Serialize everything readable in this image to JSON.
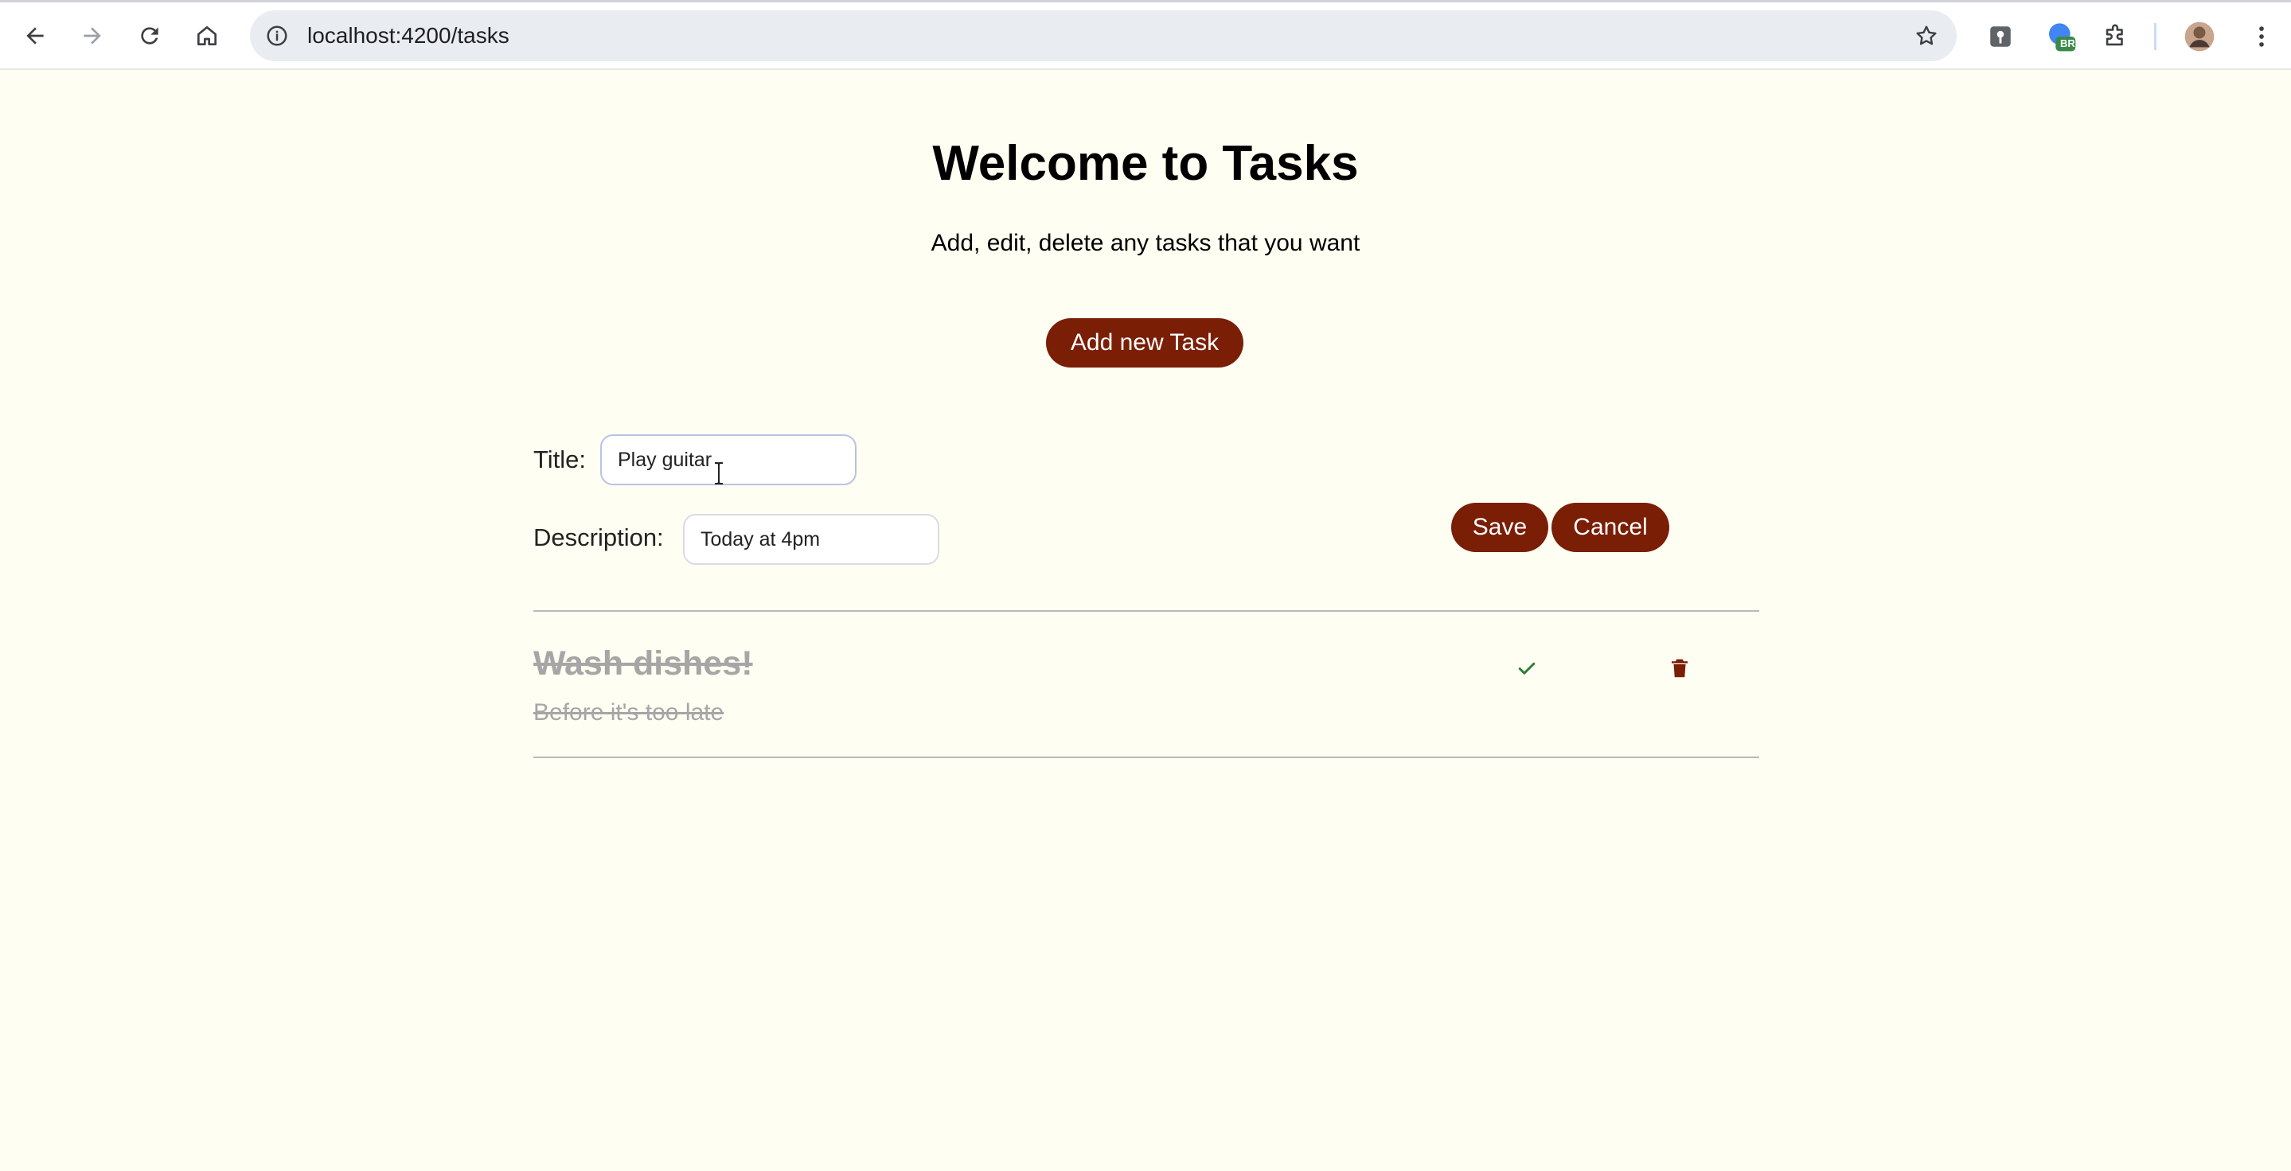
{
  "browser": {
    "url": "localhost:4200/tasks",
    "extension_badge": "BR"
  },
  "page": {
    "title": "Welcome to Tasks",
    "subtitle": "Add, edit, delete any tasks that you want",
    "add_button_label": "Add new Task"
  },
  "form": {
    "title_label": "Title:",
    "title_value": "Play guitar",
    "description_label": "Description:",
    "description_value": "Today at 4pm",
    "save_label": "Save",
    "cancel_label": "Cancel"
  },
  "tasks": [
    {
      "title": "Wash dishes!",
      "description": "Before it's too late",
      "completed": true
    }
  ],
  "colors": {
    "accent": "#7a1e06",
    "background": "#fffef2",
    "completed_text": "#a6a6a6",
    "check": "#2e7d32",
    "delete": "#7a1e06"
  }
}
